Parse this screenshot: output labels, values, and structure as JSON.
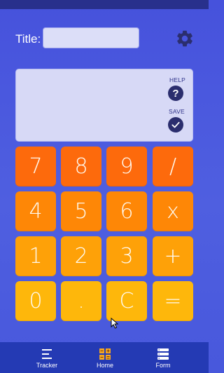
{
  "header": {
    "title_label": "Title:",
    "title_value": "",
    "settings_icon": "gear-icon"
  },
  "display": {
    "value": "",
    "help_label": "HELP",
    "help_glyph": "?",
    "save_label": "SAVE"
  },
  "keypad": {
    "rows": [
      [
        "7",
        "8",
        "9",
        "/"
      ],
      [
        "4",
        "5",
        "6",
        "x"
      ],
      [
        "1",
        "2",
        "3",
        "+"
      ],
      [
        "0",
        ".",
        "C",
        "="
      ]
    ],
    "row_colors": [
      "#fd6a0c",
      "#fe8706",
      "#fea108",
      "#feb70b"
    ]
  },
  "nav": {
    "items": [
      {
        "label": "Tracker",
        "icon": "list-icon"
      },
      {
        "label": "Home",
        "icon": "calculator-icon"
      },
      {
        "label": "Form",
        "icon": "form-icon"
      }
    ]
  },
  "colors": {
    "background": "#4a58de",
    "status_bar": "#28308c",
    "nav_bar": "#243ab4",
    "display": "#d7d9f6",
    "icon_dark": "#2b2e6e"
  }
}
